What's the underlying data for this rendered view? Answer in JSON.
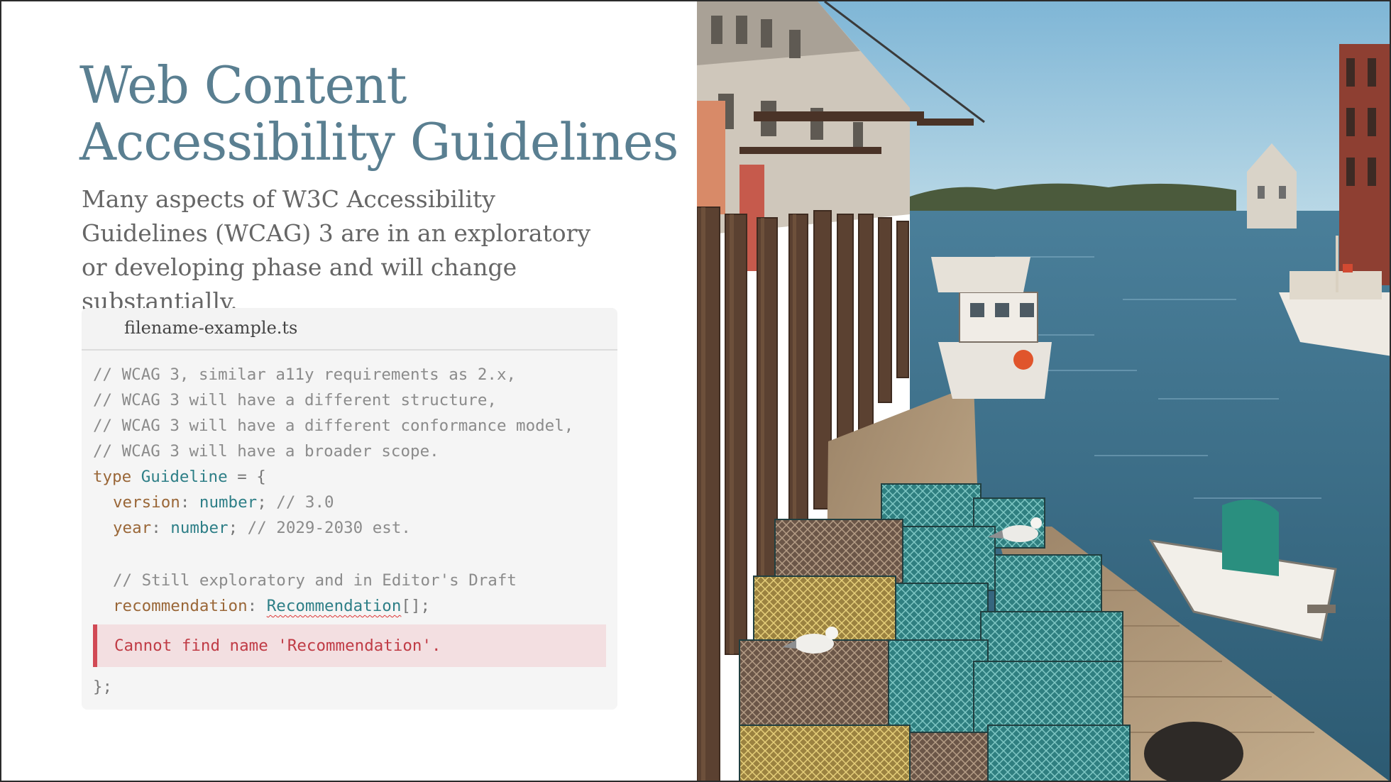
{
  "slide": {
    "title_line1": "Web Content",
    "title_line2": "Accessibility Guidelines",
    "subtitle": "Many aspects of W3C Accessibility Guidelines (WCAG) 3 are in an exploratory or developing phase and will change substantially."
  },
  "code": {
    "filename": "filename-example.ts",
    "comments": [
      "// WCAG 3, similar a11y requirements as 2.x,",
      "// WCAG 3 will have a different structure,",
      "// WCAG 3 will have a different conformance model,",
      "// WCAG 3 will have a broader scope."
    ],
    "type_kw": "type",
    "type_name": "Guideline",
    "eq_brace": " = {",
    "version_prop": "version",
    "version_type": "number",
    "version_comment": "// 3.0",
    "year_prop": "year",
    "year_type": "number",
    "year_comment": "// 2029-2030 est.",
    "draft_comment": "// Still exploratory and in Editor's Draft",
    "rec_prop": "recommendation",
    "rec_type": "Recommendation",
    "rec_suffix": "[];",
    "error_message": "Cannot find name 'Recommendation'.",
    "closing": "};"
  },
  "photo": {
    "subject": "harbor-pier-lobster-traps",
    "colors": {
      "sky": "#8fc0dc",
      "water": "#3b6f8a",
      "dock": "#b49a7c",
      "pilings": "#5a4030",
      "traps_teal": "#3f9a9b",
      "traps_yellow": "#c9ae55"
    }
  }
}
